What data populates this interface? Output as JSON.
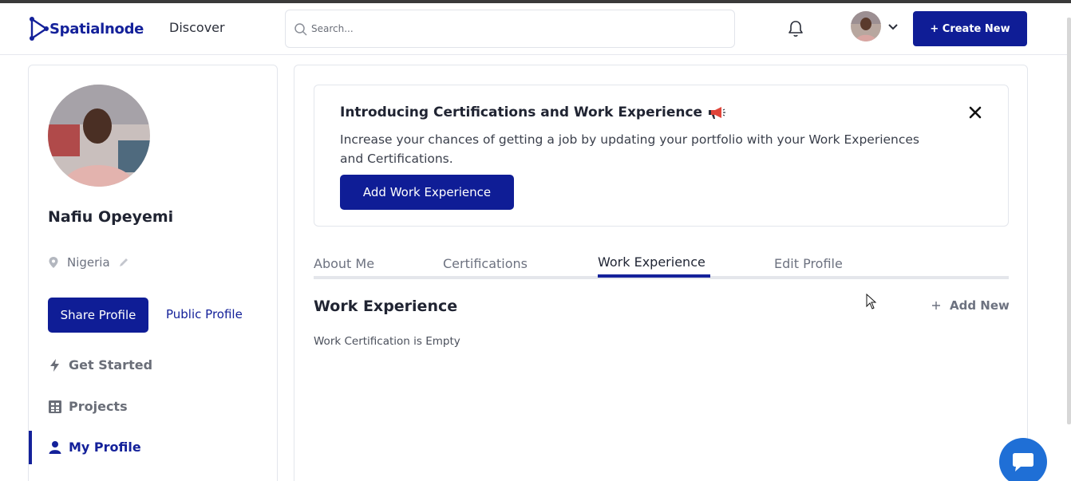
{
  "header": {
    "logo_text": "Spatialnode",
    "discover": "Discover",
    "search_placeholder": "Search...",
    "create_button": "+ Create New"
  },
  "sidebar": {
    "name": "Nafiu Opeyemi",
    "location": "Nigeria",
    "share_button": "Share Profile",
    "public_link": "Public Profile",
    "nav": [
      {
        "label": "Get Started",
        "icon": "bolt-icon"
      },
      {
        "label": "Projects",
        "icon": "grid-icon"
      },
      {
        "label": "My Profile",
        "icon": "user-icon",
        "active": true
      }
    ]
  },
  "banner": {
    "title": "Introducing Certifications and Work Experience",
    "text": "Increase your chances of getting a job by updating your portfolio with your Work Experiences and Certifications.",
    "button": "Add Work Experience"
  },
  "tabs": [
    {
      "label": "About Me"
    },
    {
      "label": "Certifications"
    },
    {
      "label": "Work Experience",
      "active": true
    },
    {
      "label": "Edit Profile"
    }
  ],
  "section": {
    "title": "Work Experience",
    "add_new": "Add New",
    "empty": "Work Certification is Empty"
  },
  "colors": {
    "primary": "#0f1d96",
    "chat": "#1f6fd6"
  }
}
